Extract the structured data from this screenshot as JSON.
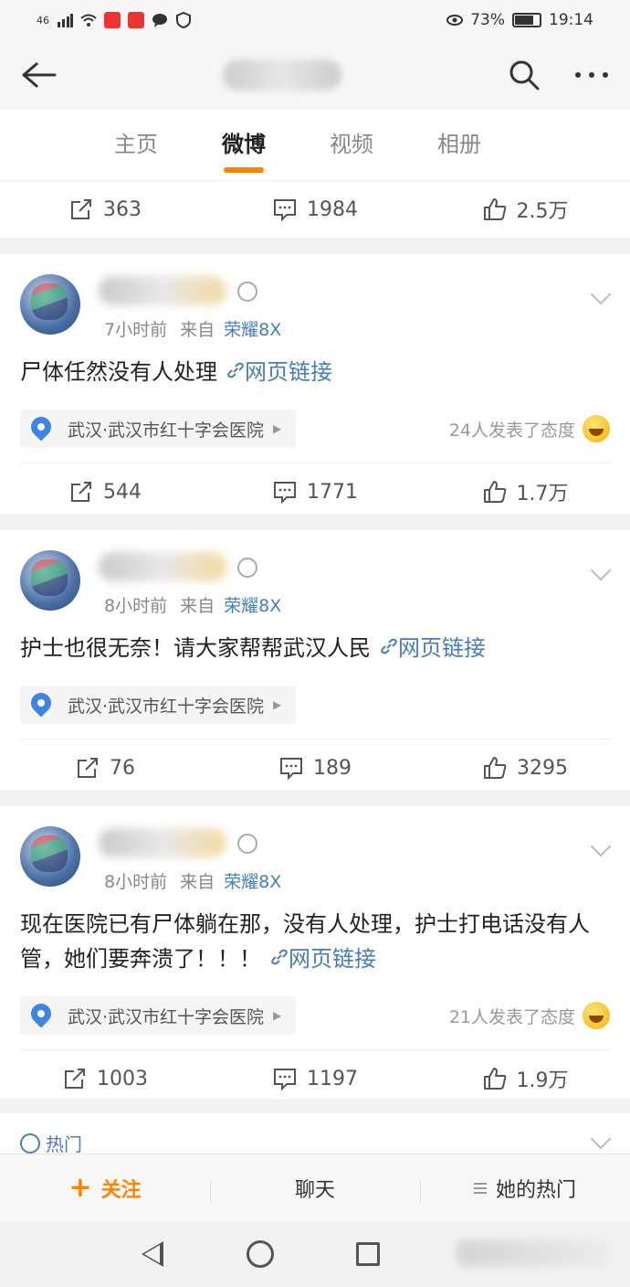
{
  "status_bar": {
    "network": "46",
    "battery": "73%",
    "time": "19:14"
  },
  "icons": {
    "back": "arrow-left",
    "search": "magnifier",
    "more": "three-dots",
    "repost": "square-arrow",
    "comment": "speech-bubble",
    "like": "thumbs-up",
    "location": "map-pin",
    "link": "chain-link",
    "hot": "fire-circle"
  },
  "tabs": [
    {
      "label": "主页",
      "active": false
    },
    {
      "label": "微博",
      "active": true
    },
    {
      "label": "视频",
      "active": false
    },
    {
      "label": "相册",
      "active": false
    }
  ],
  "top_stats": {
    "repost": "363",
    "comment": "1984",
    "like": "2.5万"
  },
  "posts": [
    {
      "time": "7小时前",
      "from_label": "来自",
      "device": "荣耀8X",
      "text": "尸体任然没有人处理",
      "link_label": "网页链接",
      "location": "武汉·武汉市红十字会医院",
      "attitude": "24人发表了态度",
      "stats": {
        "repost": "544",
        "comment": "1771",
        "like": "1.7万"
      }
    },
    {
      "time": "8小时前",
      "from_label": "来自",
      "device": "荣耀8X",
      "text": "护士也很无奈！请大家帮帮武汉人民",
      "link_label": "网页链接",
      "location": "武汉·武汉市红十字会医院",
      "attitude": "",
      "stats": {
        "repost": "76",
        "comment": "189",
        "like": "3295"
      }
    },
    {
      "time": "8小时前",
      "from_label": "来自",
      "device": "荣耀8X",
      "text": "现在医院已有尸体躺在那，没有人处理，护士打电话没有人管，她们要奔溃了！！！",
      "link_label": "网页链接",
      "location": "武汉·武汉市红十字会医院",
      "attitude": "21人发表了态度",
      "stats": {
        "repost": "1003",
        "comment": "1197",
        "like": "1.9万"
      }
    }
  ],
  "hot_section": {
    "label": "热门"
  },
  "bottom_bar": {
    "follow": "关注",
    "chat": "聊天",
    "her_hot": "她的热门"
  },
  "colors": {
    "accent": "#ff8200",
    "link": "#4a7db8"
  }
}
